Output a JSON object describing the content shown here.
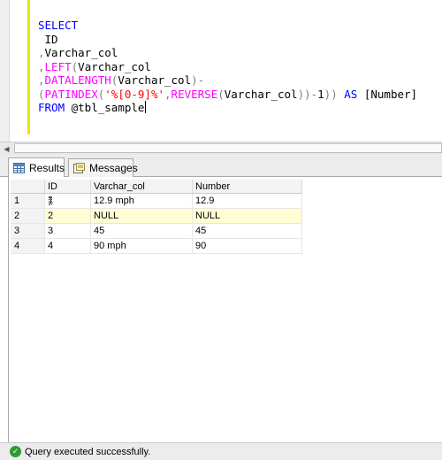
{
  "editor": {
    "lines": [
      [
        {
          "t": "SELECT",
          "c": "kw"
        }
      ],
      [
        {
          "t": " ID",
          "c": ""
        }
      ],
      [
        {
          "t": ",",
          "c": "op"
        },
        {
          "t": "Varchar_col",
          "c": ""
        }
      ],
      [
        {
          "t": ",",
          "c": "op"
        },
        {
          "t": "LEFT",
          "c": "fn"
        },
        {
          "t": "(",
          "c": "op"
        },
        {
          "t": "Varchar_col",
          "c": ""
        }
      ],
      [
        {
          "t": ",",
          "c": "op"
        },
        {
          "t": "DATALENGTH",
          "c": "fn"
        },
        {
          "t": "(",
          "c": "op"
        },
        {
          "t": "Varchar_col",
          "c": ""
        },
        {
          "t": ")-",
          "c": "op"
        }
      ],
      [
        {
          "t": "(",
          "c": "op"
        },
        {
          "t": "PATINDEX",
          "c": "fn"
        },
        {
          "t": "(",
          "c": "op"
        },
        {
          "t": "'%[0-9]%'",
          "c": "str"
        },
        {
          "t": ",",
          "c": "op"
        },
        {
          "t": "REVERSE",
          "c": "fn"
        },
        {
          "t": "(",
          "c": "op"
        },
        {
          "t": "Varchar_col",
          "c": ""
        },
        {
          "t": "))-",
          "c": "op"
        },
        {
          "t": "1",
          "c": ""
        },
        {
          "t": "))",
          "c": "op"
        },
        {
          "t": " ",
          "c": ""
        },
        {
          "t": "AS",
          "c": "kw"
        },
        {
          "t": " [Number]",
          "c": ""
        }
      ],
      [
        {
          "t": "FROM",
          "c": "kw"
        },
        {
          "t": " @tbl_sample",
          "c": ""
        }
      ]
    ]
  },
  "tabs": {
    "results_label": "Results",
    "messages_label": "Messages"
  },
  "grid": {
    "columns": [
      "ID",
      "Varchar_col",
      "Number"
    ],
    "rows": [
      {
        "num": "1",
        "cells": [
          "1",
          "12.9 mph",
          "12.9"
        ]
      },
      {
        "num": "2",
        "cells": [
          "2",
          "NULL",
          "NULL"
        ]
      },
      {
        "num": "3",
        "cells": [
          "3",
          "45",
          "45"
        ]
      },
      {
        "num": "4",
        "cells": [
          "4",
          "90 mph",
          "90"
        ]
      }
    ],
    "selected_row": 1,
    "focused_cell": [
      0,
      0
    ]
  },
  "status": {
    "message": "Query executed successfully."
  },
  "colors": {
    "keyword": "#0000ff",
    "function": "#ff00ff",
    "operator": "#808080",
    "string": "#ff0000",
    "null_row_highlight": "#fffdd4",
    "success": "#2e9b2e"
  },
  "icons": {
    "results_tab": "grid-icon",
    "messages_tab": "messages-icon",
    "status": "success-check-icon"
  }
}
